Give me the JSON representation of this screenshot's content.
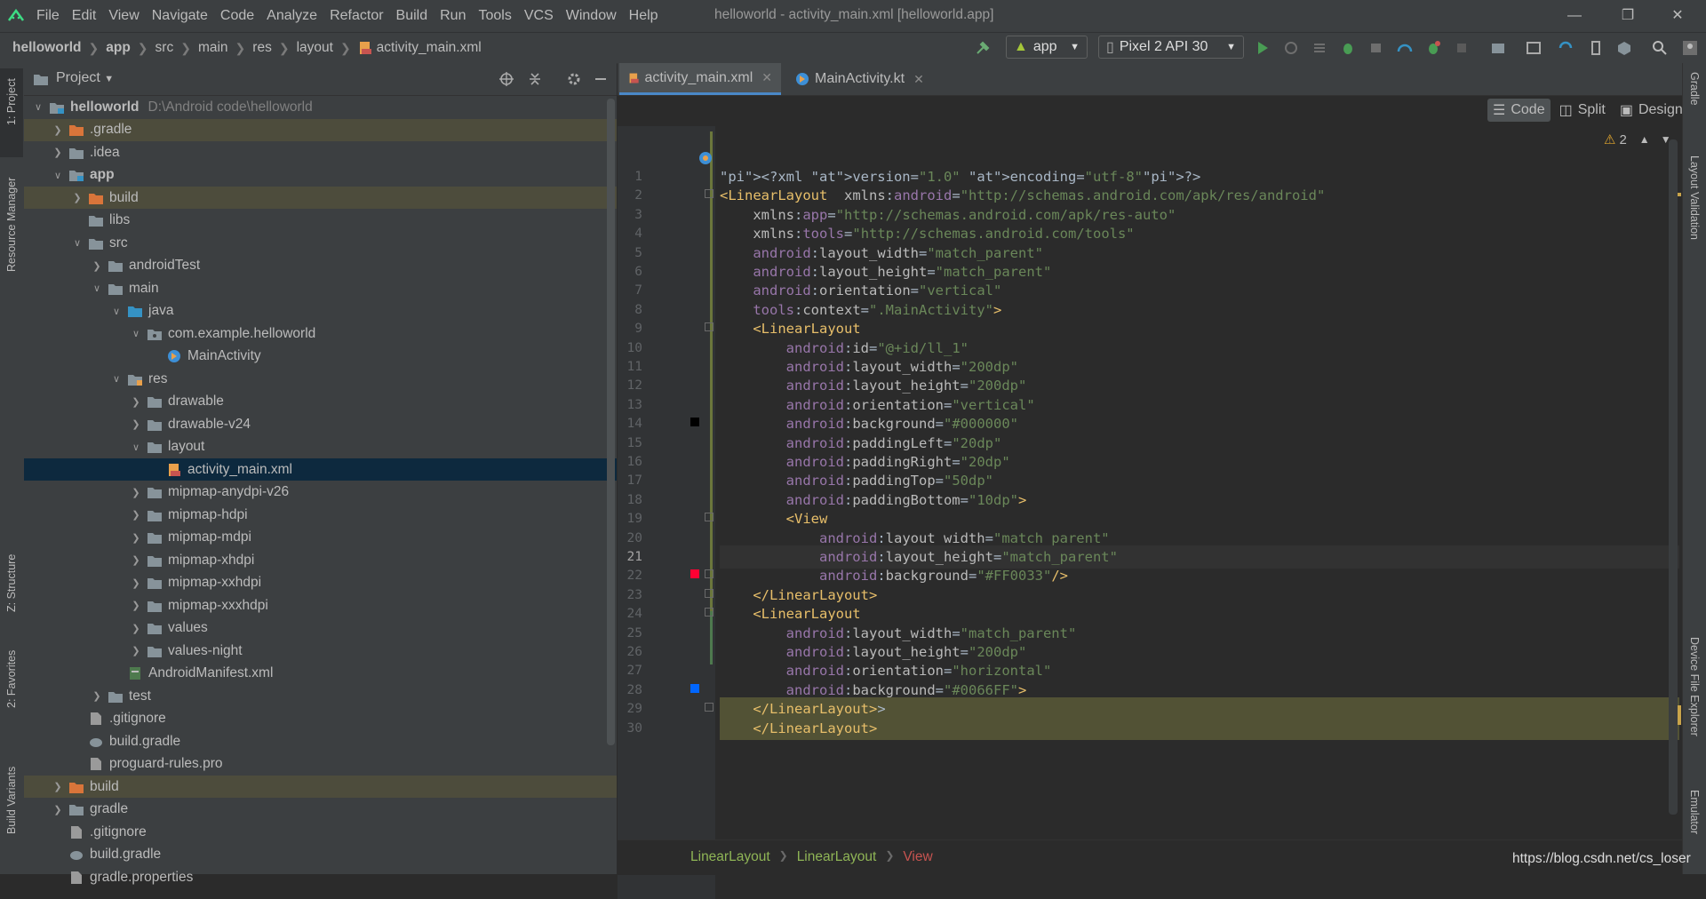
{
  "menu": [
    "File",
    "Edit",
    "View",
    "Navigate",
    "Code",
    "Analyze",
    "Refactor",
    "Build",
    "Run",
    "Tools",
    "VCS",
    "Window",
    "Help"
  ],
  "window_title": "helloworld - activity_main.xml [helloworld.app]",
  "breadcrumbs": [
    "helloworld",
    "app",
    "src",
    "main",
    "res",
    "layout",
    "activity_main.xml"
  ],
  "toolbar": {
    "run_config": "app",
    "device": "Pixel 2 API 30"
  },
  "left_stripe": [
    "1: Project",
    "Resource Manager",
    "Z: Structure",
    "2: Favorites",
    "Build Variants"
  ],
  "right_stripe": [
    "Gradle",
    "Layout Validation",
    "Device File Explorer",
    "Emulator"
  ],
  "project": {
    "title": "Project",
    "tree": [
      {
        "label": "helloworld",
        "extra": "D:\\Android code\\helloworld",
        "depth": 0,
        "arrow": "open",
        "icon": "module",
        "bold": true
      },
      {
        "label": ".gradle",
        "depth": 1,
        "arrow": "closed",
        "icon": "folder-orange",
        "hl": true
      },
      {
        "label": ".idea",
        "depth": 1,
        "arrow": "closed",
        "icon": "folder"
      },
      {
        "label": "app",
        "depth": 1,
        "arrow": "open",
        "icon": "module",
        "bold": true
      },
      {
        "label": "build",
        "depth": 2,
        "arrow": "closed",
        "icon": "folder-orange",
        "hl": true
      },
      {
        "label": "libs",
        "depth": 2,
        "arrow": "none",
        "icon": "folder"
      },
      {
        "label": "src",
        "depth": 2,
        "arrow": "open",
        "icon": "folder"
      },
      {
        "label": "androidTest",
        "depth": 3,
        "arrow": "closed",
        "icon": "folder"
      },
      {
        "label": "main",
        "depth": 3,
        "arrow": "open",
        "icon": "folder"
      },
      {
        "label": "java",
        "depth": 4,
        "arrow": "open",
        "icon": "folder-blue"
      },
      {
        "label": "com.example.helloworld",
        "depth": 5,
        "arrow": "open",
        "icon": "package"
      },
      {
        "label": "MainActivity",
        "depth": 6,
        "arrow": "none",
        "icon": "kotlin"
      },
      {
        "label": "res",
        "depth": 4,
        "arrow": "open",
        "icon": "res"
      },
      {
        "label": "drawable",
        "depth": 5,
        "arrow": "closed",
        "icon": "folder"
      },
      {
        "label": "drawable-v24",
        "depth": 5,
        "arrow": "closed",
        "icon": "folder"
      },
      {
        "label": "layout",
        "depth": 5,
        "arrow": "open",
        "icon": "folder"
      },
      {
        "label": "activity_main.xml",
        "depth": 6,
        "arrow": "none",
        "icon": "xml",
        "sel": true
      },
      {
        "label": "mipmap-anydpi-v26",
        "depth": 5,
        "arrow": "closed",
        "icon": "folder"
      },
      {
        "label": "mipmap-hdpi",
        "depth": 5,
        "arrow": "closed",
        "icon": "folder"
      },
      {
        "label": "mipmap-mdpi",
        "depth": 5,
        "arrow": "closed",
        "icon": "folder"
      },
      {
        "label": "mipmap-xhdpi",
        "depth": 5,
        "arrow": "closed",
        "icon": "folder"
      },
      {
        "label": "mipmap-xxhdpi",
        "depth": 5,
        "arrow": "closed",
        "icon": "folder"
      },
      {
        "label": "mipmap-xxxhdpi",
        "depth": 5,
        "arrow": "closed",
        "icon": "folder"
      },
      {
        "label": "values",
        "depth": 5,
        "arrow": "closed",
        "icon": "folder"
      },
      {
        "label": "values-night",
        "depth": 5,
        "arrow": "closed",
        "icon": "folder"
      },
      {
        "label": "AndroidManifest.xml",
        "depth": 4,
        "arrow": "none",
        "icon": "manifest"
      },
      {
        "label": "test",
        "depth": 3,
        "arrow": "closed",
        "icon": "folder"
      },
      {
        "label": ".gitignore",
        "depth": 2,
        "arrow": "none",
        "icon": "file"
      },
      {
        "label": "build.gradle",
        "depth": 2,
        "arrow": "none",
        "icon": "gradle"
      },
      {
        "label": "proguard-rules.pro",
        "depth": 2,
        "arrow": "none",
        "icon": "file"
      },
      {
        "label": "build",
        "depth": 1,
        "arrow": "closed",
        "icon": "folder-orange",
        "hl": true
      },
      {
        "label": "gradle",
        "depth": 1,
        "arrow": "closed",
        "icon": "folder"
      },
      {
        "label": ".gitignore",
        "depth": 1,
        "arrow": "none",
        "icon": "file"
      },
      {
        "label": "build.gradle",
        "depth": 1,
        "arrow": "none",
        "icon": "gradle"
      },
      {
        "label": "gradle.properties",
        "depth": 1,
        "arrow": "none",
        "icon": "file"
      }
    ]
  },
  "tabs": [
    {
      "label": "activity_main.xml",
      "active": true
    },
    {
      "label": "MainActivity.kt",
      "active": false
    }
  ],
  "view_modes": [
    "Code",
    "Split",
    "Design"
  ],
  "warnings": "2",
  "code_lines": [
    "<?xml version=\"1.0\" encoding=\"utf-8\"?>",
    "<LinearLayout  xmlns:android=\"http://schemas.android.com/apk/res/android\"",
    "    xmlns:app=\"http://schemas.android.com/apk/res-auto\"",
    "    xmlns:tools=\"http://schemas.android.com/tools\"",
    "    android:layout_width=\"match_parent\"",
    "    android:layout_height=\"match_parent\"",
    "    android:orientation=\"vertical\"",
    "    tools:context=\".MainActivity\">",
    "    <LinearLayout",
    "        android:id=\"@+id/ll_1\"",
    "        android:layout_width=\"200dp\"",
    "        android:layout_height=\"200dp\"",
    "        android:orientation=\"vertical\"",
    "        android:background=\"#000000\"",
    "        android:paddingLeft=\"20dp\"",
    "        android:paddingRight=\"20dp\"",
    "        android:paddingTop=\"50dp\"",
    "        android:paddingBottom=\"10dp\">",
    "        <View",
    "            android:layout_width=\"match_parent\"",
    "            android:layout_height=\"match_parent\"",
    "            android:background=\"#FF0033\"/>",
    "    </LinearLayout>",
    "    <LinearLayout",
    "        android:layout_width=\"match_parent\"",
    "        android:layout_height=\"200dp\"",
    "        android:orientation=\"horizontal\"",
    "        android:background=\"#0066FF\">",
    "    </LinearLayout>>",
    "    </LinearLayout>"
  ],
  "color_swatches": {
    "14": "#000000",
    "22": "#FF0033",
    "28": "#0066FF"
  },
  "bottom_breadcrumbs": [
    "LinearLayout",
    "LinearLayout",
    "View"
  ],
  "watermark": "https://blog.csdn.net/cs_loser"
}
